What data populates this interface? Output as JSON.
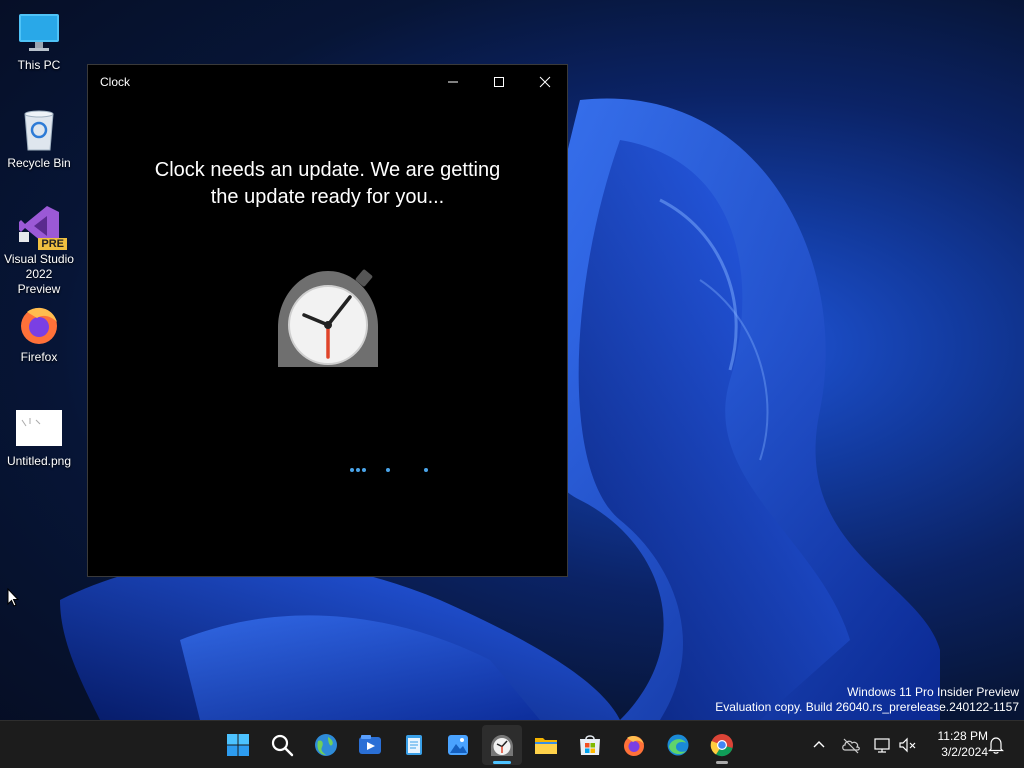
{
  "desktop": {
    "icons": [
      {
        "label": "This PC"
      },
      {
        "label": "Recycle Bin"
      },
      {
        "label": "Visual Studio 2022 Preview",
        "badge": "PRE"
      },
      {
        "label": "Firefox"
      },
      {
        "label": "Untitled.png"
      }
    ]
  },
  "window": {
    "title": "Clock",
    "message_line1": "Clock needs an update. We are getting",
    "message_line2": "the update ready for you..."
  },
  "watermark": {
    "line1": "Windows 11 Pro Insider Preview",
    "line2": "Evaluation copy. Build 26040.rs_prerelease.240122-1157"
  },
  "taskbar": {
    "apps": [
      "start-icon",
      "search-icon",
      "maps-icon",
      "media-player-icon",
      "notepad-icon",
      "photos-icon",
      "clock-icon",
      "file-explorer-icon",
      "store-icon",
      "firefox-icon",
      "edge-icon",
      "chrome-icon"
    ],
    "active_app": "clock-icon"
  },
  "tray": {
    "time": "11:28 PM",
    "date": "3/2/2024"
  },
  "colors": {
    "accent": "#4cc2ff",
    "taskbar": "#1c1c1c",
    "window_bg": "#000000"
  }
}
